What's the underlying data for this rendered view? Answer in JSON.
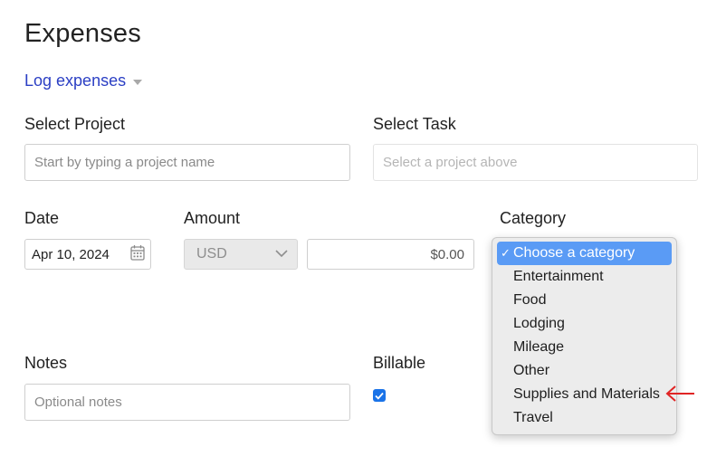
{
  "page": {
    "title": "Expenses"
  },
  "log_link": {
    "label": "Log expenses"
  },
  "project": {
    "label": "Select Project",
    "placeholder": "Start by typing a project name"
  },
  "task": {
    "label": "Select Task",
    "placeholder": "Select a project above"
  },
  "date": {
    "label": "Date",
    "value": "Apr 10, 2024"
  },
  "amount": {
    "label": "Amount",
    "currency": "USD",
    "value": "$0.00"
  },
  "category": {
    "label": "Category",
    "check_glyph": "✓",
    "options": [
      {
        "label": "Choose a category",
        "selected": true
      },
      {
        "label": "Entertainment"
      },
      {
        "label": "Food"
      },
      {
        "label": "Lodging"
      },
      {
        "label": "Mileage"
      },
      {
        "label": "Other"
      },
      {
        "label": "Supplies and Materials",
        "annotated": true
      },
      {
        "label": "Travel"
      }
    ]
  },
  "notes": {
    "label": "Notes",
    "placeholder": "Optional notes"
  },
  "billable": {
    "label": "Billable",
    "checked": true
  },
  "colors": {
    "link": "#2b3fc4",
    "highlight": "#5a9bf5",
    "checkbox": "#1a73e8",
    "annotation_arrow": "#e02424"
  },
  "icons": {
    "calendar": "calendar-icon",
    "chevron": "chevron-down-icon",
    "caret": "caret-down-icon",
    "annotation": "red-arrow-icon"
  }
}
